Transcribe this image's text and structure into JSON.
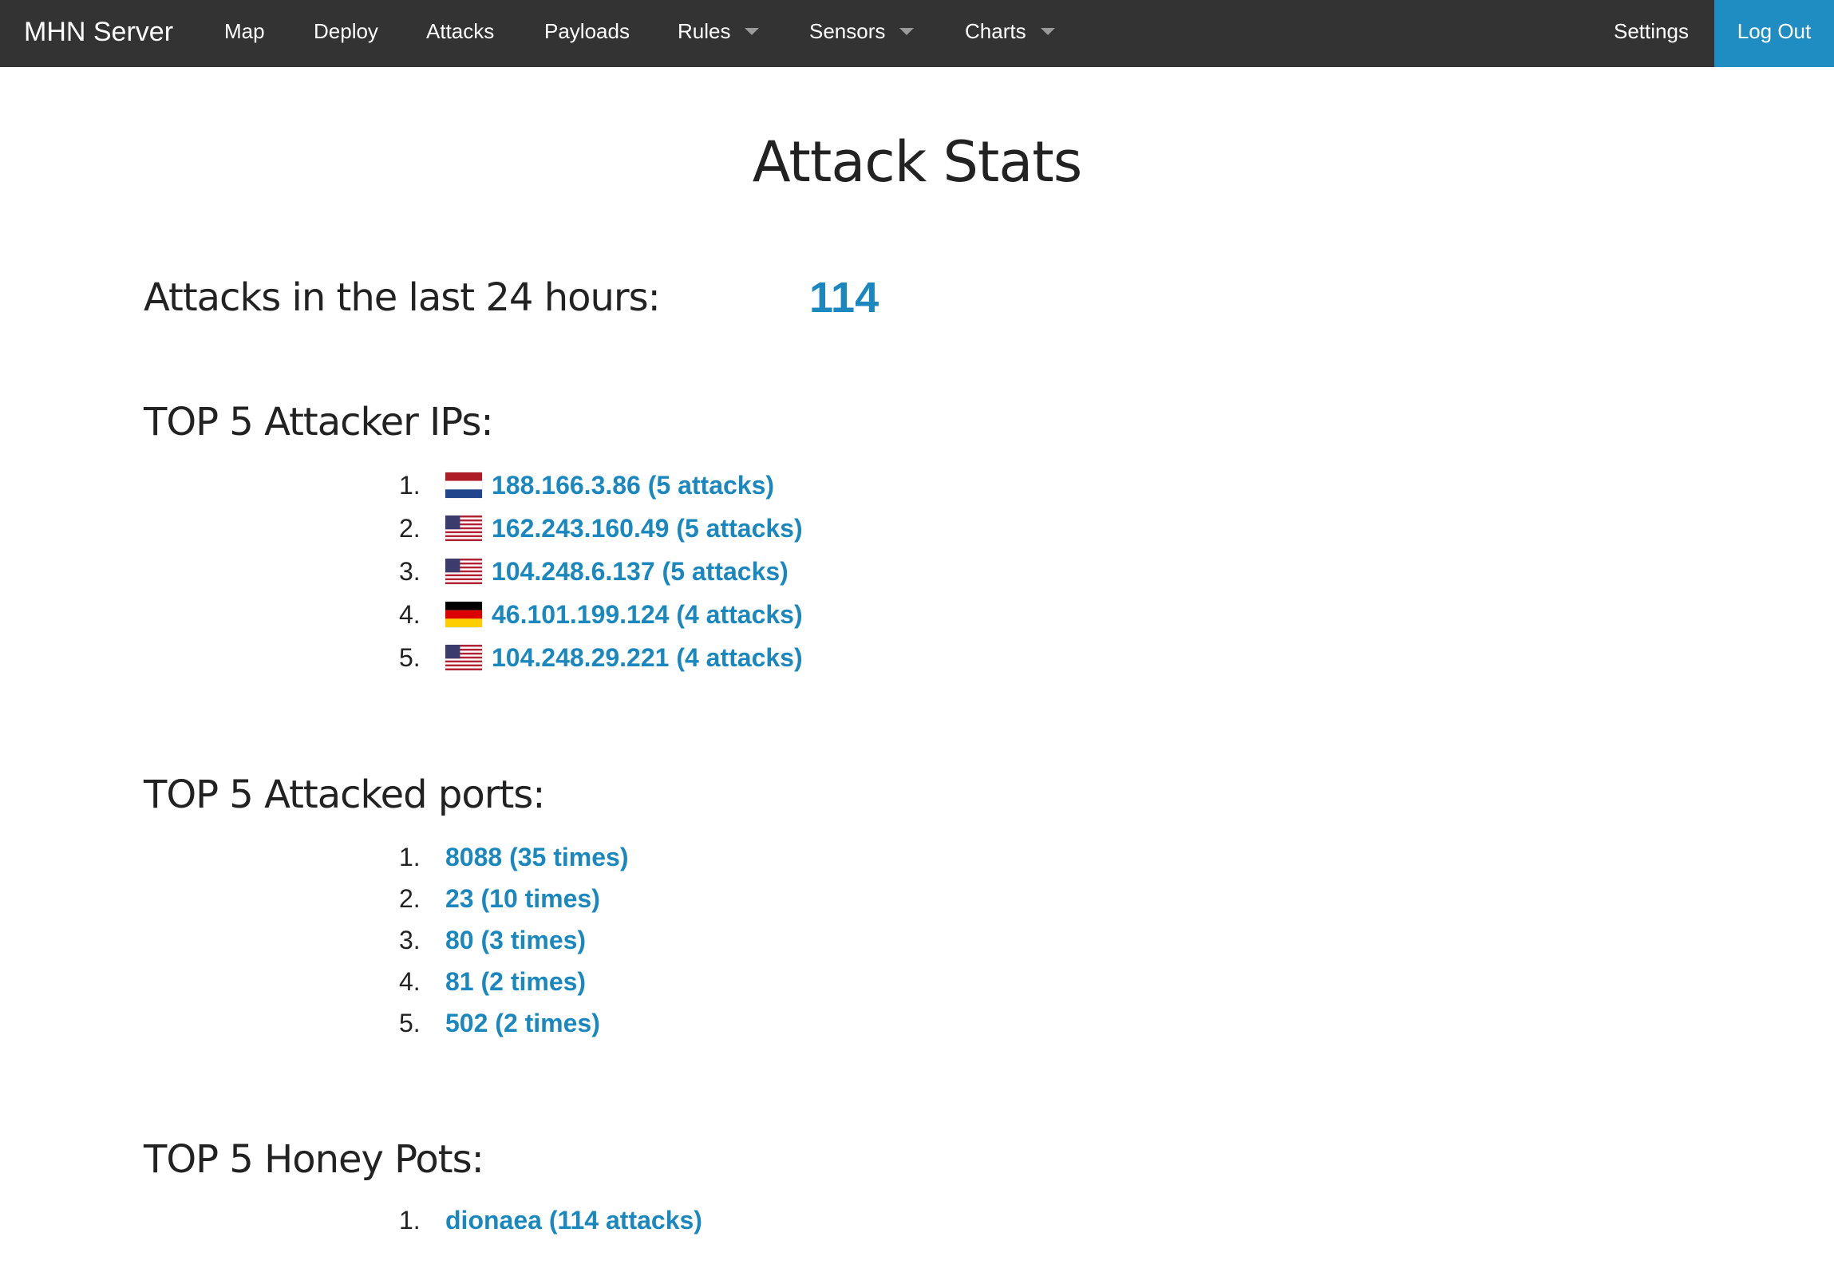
{
  "navbar": {
    "brand": "MHN Server",
    "items": [
      {
        "label": "Map",
        "dropdown": false
      },
      {
        "label": "Deploy",
        "dropdown": false
      },
      {
        "label": "Attacks",
        "dropdown": false
      },
      {
        "label": "Payloads",
        "dropdown": false
      },
      {
        "label": "Rules",
        "dropdown": true
      },
      {
        "label": "Sensors",
        "dropdown": true
      },
      {
        "label": "Charts",
        "dropdown": true
      }
    ],
    "settings": "Settings",
    "logout": "Log Out"
  },
  "colors": {
    "navbar_bg": "#333333",
    "accent": "#1f8dc1",
    "link": "#1a88bf"
  },
  "page": {
    "title": "Attack Stats",
    "attacks_24h_label": "Attacks in the last 24 hours:",
    "attacks_24h_value": "114"
  },
  "top_ips": {
    "heading": "TOP 5 Attacker IPs:",
    "items": [
      {
        "rank": "1.",
        "text": "188.166.3.86 (5 attacks)",
        "flag": "flag-netherlands-icon"
      },
      {
        "rank": "2.",
        "text": "162.243.160.49 (5 attacks)",
        "flag": "flag-united-states-icon"
      },
      {
        "rank": "3.",
        "text": "104.248.6.137 (5 attacks)",
        "flag": "flag-united-states-icon"
      },
      {
        "rank": "4.",
        "text": "46.101.199.124 (4 attacks)",
        "flag": "flag-germany-icon"
      },
      {
        "rank": "5.",
        "text": "104.248.29.221 (4 attacks)",
        "flag": "flag-united-states-icon"
      }
    ]
  },
  "top_ports": {
    "heading": "TOP 5 Attacked ports:",
    "items": [
      {
        "rank": "1.",
        "text": "8088 (35 times)"
      },
      {
        "rank": "2.",
        "text": "23 (10 times)"
      },
      {
        "rank": "3.",
        "text": "80 (3 times)"
      },
      {
        "rank": "4.",
        "text": "81 (2 times)"
      },
      {
        "rank": "5.",
        "text": "502 (2 times)"
      }
    ]
  },
  "top_pots": {
    "heading": "TOP 5 Honey Pots:",
    "items": [
      {
        "rank": "1.",
        "text": "dionaea (114 attacks)"
      }
    ]
  }
}
